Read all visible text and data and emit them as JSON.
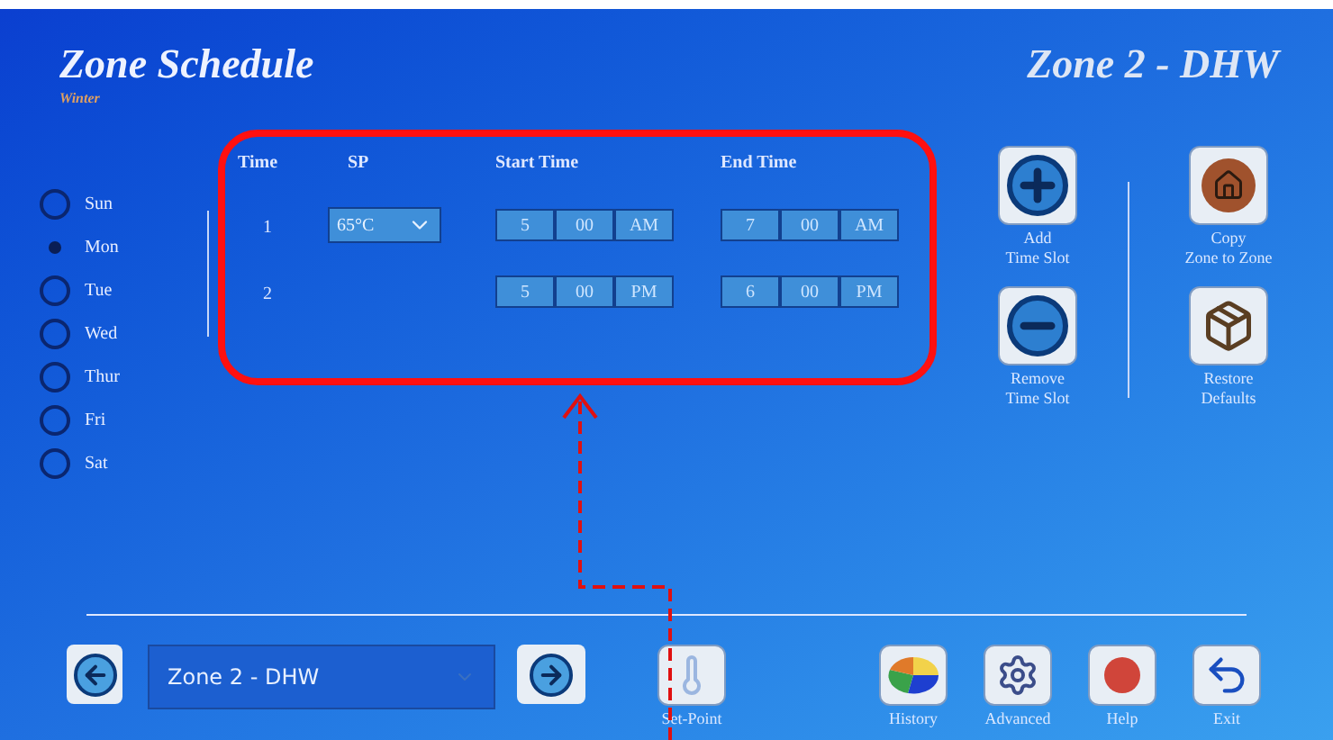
{
  "header": {
    "title": "Zone Schedule",
    "season": "Winter",
    "zone_title": "Zone 2 - DHW"
  },
  "days": [
    {
      "label": "Sun",
      "selected": false
    },
    {
      "label": "Mon",
      "selected": true
    },
    {
      "label": "Tue",
      "selected": false
    },
    {
      "label": "Wed",
      "selected": false
    },
    {
      "label": "Thur",
      "selected": false
    },
    {
      "label": "Fri",
      "selected": false
    },
    {
      "label": "Sat",
      "selected": false
    }
  ],
  "schedule": {
    "columns": [
      "Time",
      "SP",
      "Start Time",
      "End Time"
    ],
    "rows": [
      {
        "slot": "1",
        "sp": "65°C",
        "start": [
          "5",
          "00",
          "AM"
        ],
        "end": [
          "7",
          "00",
          "AM"
        ]
      },
      {
        "slot": "2",
        "start": [
          "5",
          "00",
          "PM"
        ],
        "end": [
          "6",
          "00",
          "PM"
        ]
      }
    ]
  },
  "actions": [
    {
      "kind": "add",
      "label": "Add\nTime Slot"
    },
    {
      "kind": "copy",
      "label": "Copy\nZone to Zone"
    },
    {
      "kind": "remove",
      "label": "Remove\nTime Slot"
    },
    {
      "kind": "restore",
      "label": "Restore\nDefaults"
    }
  ],
  "footer": {
    "zone_select": "Zone 2 - DHW",
    "buttons": [
      {
        "kind": "setpoint",
        "label": "Set-Point"
      },
      {
        "kind": "history",
        "label": "History"
      },
      {
        "kind": "advanced",
        "label": "Advanced"
      },
      {
        "kind": "help",
        "label": "Help"
      },
      {
        "kind": "exit",
        "label": "Exit"
      }
    ]
  }
}
